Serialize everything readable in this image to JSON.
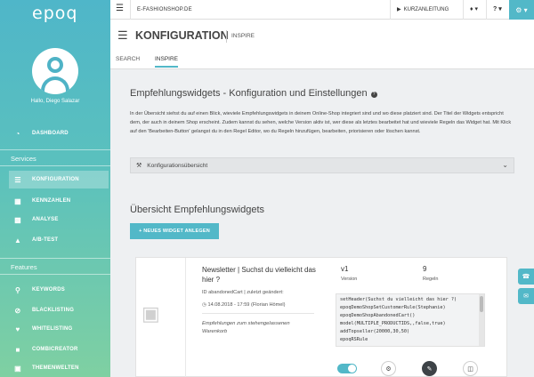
{
  "brand": {
    "logo_text": "epoq",
    "accent": "#52b8c8"
  },
  "user": {
    "greeting": "Hallo, Diego Salazar"
  },
  "sidebar": {
    "dashboard": "DASHBOARD",
    "services_label": "Services",
    "services": [
      {
        "label": "KONFIGURATION",
        "icon": "sliders-icon",
        "active": true
      },
      {
        "label": "KENNZAHLEN",
        "icon": "table-icon"
      },
      {
        "label": "ANALYSE",
        "icon": "chart-icon"
      },
      {
        "label": "A/B-TEST",
        "icon": "flask-icon"
      }
    ],
    "features_label": "Features",
    "features": [
      {
        "label": "KEYWORDS",
        "icon": "search-icon"
      },
      {
        "label": "BLACKLISTING",
        "icon": "block-icon"
      },
      {
        "label": "WHITELISTING",
        "icon": "heart-icon"
      },
      {
        "label": "COMBICREATOR",
        "icon": "gift-icon"
      },
      {
        "label": "THEMENWELTEN",
        "icon": "grid-icon"
      }
    ]
  },
  "topbar": {
    "shop": "E-FASHIONSHOP.DE",
    "kurzanleitung": "KURZANLEITUNG",
    "help": "?"
  },
  "header": {
    "title": "KONFIGURATION",
    "subtitle": "INSPIRE",
    "tabs": [
      "SEARCH",
      "INSPIRE"
    ]
  },
  "main": {
    "heading": "Empfehlungswidgets - Konfiguration und Einstellungen",
    "intro": "In der Übersicht siehst du auf einen Blick, wieviele Empfehlungswidgets in deinem Online-Shop integriert sind und wo diese platziert sind. Der Titel der Widgets entspricht dem, der auch in deinem Shop erscheint. Zudem kannst du sehen, welche Version aktiv ist, wer diese als letztes bearbeitet hat und wieviele Regeln das Widget hat. Mit Klick auf den 'Bearbeiten-Button' gelangst du in den Regel Editor, wo du Regeln hinzufügen, bearbeiten, priorisieren oder löschen kannst.",
    "accordion": "Konfigurationsübersicht",
    "overview_heading": "Übersicht Empfehlungswidgets",
    "new_widget_button": "+ NEUES WIDGET ANLEGEN"
  },
  "widget": {
    "title": "Newsletter | Suchst du vielleicht das hier ?",
    "id_line": "ID abandonedCart | zuletzt geändert:",
    "date_line": "14.08.2018 - 17:59 (Florian Hömel)",
    "description": "Empfehlungen zum stehengelassenen Warenkorb",
    "version_value": "v1",
    "version_label": "Version",
    "rules_value": "9",
    "rules_label": "Regeln",
    "code": "setHeader(Suchst du vielleicht das hier ?)\nepoqDemoShopSetCustomerRule(Stephanie)\nepoqDemoShopAbandonedCart()\nmodel(MULTIPLE_PRODUCTIDS,,false,true)\naddTopseller(20000,30,50)\nepoqRSRule",
    "active": true
  }
}
